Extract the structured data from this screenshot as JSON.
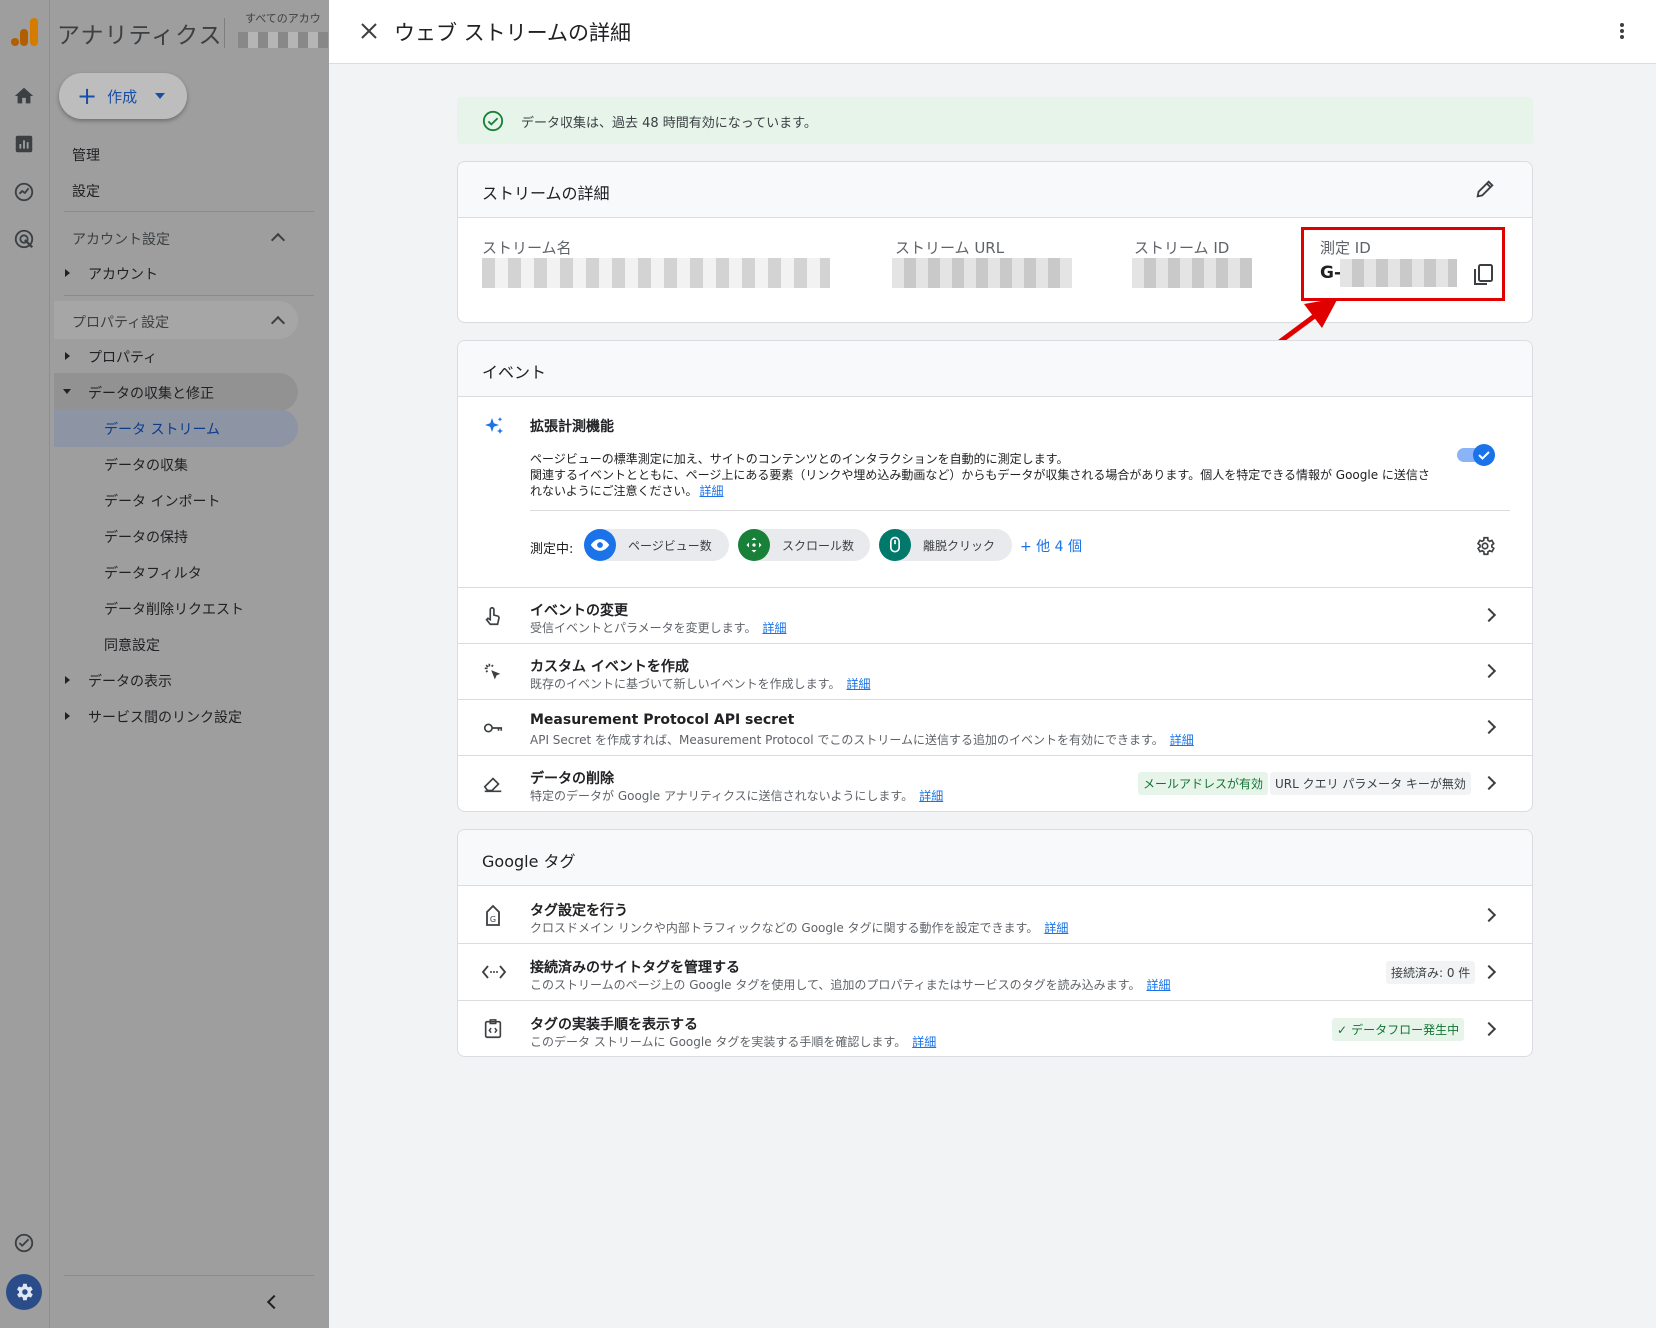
{
  "nav": {
    "app_title": "アナリティクス",
    "account_small": "すべてのアカウ",
    "create_label": "作成",
    "admin": "管理",
    "settings": "設定",
    "account_section": "アカウント設定",
    "account": "アカウント",
    "property_section": "プロパティ設定",
    "property": "プロパティ",
    "data_collection_modification": "データの収集と修正",
    "items": [
      "データ ストリーム",
      "データの収集",
      "データ インポート",
      "データの保持",
      "データフィルタ",
      "データ削除リクエスト",
      "同意設定"
    ],
    "data_display": "データの表示",
    "service_links": "サービス間のリンク設定"
  },
  "header": {
    "title": "ウェブ ストリームの詳細"
  },
  "banner": {
    "text": "データ収集は、過去 48 時間有効になっています。"
  },
  "stream_details": {
    "title": "ストリームの詳細",
    "stream_name_label": "ストリーム名",
    "stream_url_label": "ストリーム URL",
    "stream_id_label": "ストリーム ID",
    "measurement_id_label": "測定 ID",
    "measurement_id_prefix": "G-"
  },
  "events": {
    "title": "イベント",
    "enhanced": {
      "title": "拡張計測機能",
      "desc_line1": "ページビューの標準測定に加え、サイトのコンテンツとのインタラクションを自動的に測定します。",
      "desc_line2": "関連するイベントとともに、ページ上にある要素（リンクや埋め込み動画など）からもデータが収集される場合があります。個人を特定できる情報が Google に送信さ",
      "desc_line3": "れないようにご注意ください。",
      "link": "詳細",
      "toggle_on": true,
      "measuring_label": "測定中:",
      "chips": [
        "ページビュー数",
        "スクロール数",
        "離脱クリック"
      ],
      "more": "+ 他 4 個"
    },
    "rows": [
      {
        "title": "イベントの変更",
        "desc": "受信イベントとパラメータを変更します。",
        "link": "詳細"
      },
      {
        "title": "カスタム イベントを作成",
        "desc": "既存のイベントに基づいて新しいイベントを作成します。",
        "link": "詳細"
      },
      {
        "title": "Measurement Protocol API secret",
        "desc": "API Secret を作成すれば、Measurement Protocol でこのストリームに送信する追加のイベントを有効にできます。",
        "link": "詳細"
      },
      {
        "title": "データの削除",
        "desc": "特定のデータが Google アナリティクスに送信されないようにします。",
        "link": "詳細",
        "badge_email": "メールアドレスが有効",
        "badge_url": "URL クエリ パラメータ キーが無効"
      }
    ]
  },
  "google_tag": {
    "title": "Google タグ",
    "rows": [
      {
        "title": "タグ設定を行う",
        "desc": "クロスドメイン リンクや内部トラフィックなどの Google タグに関する動作を設定できます。",
        "link": "詳細"
      },
      {
        "title": "接続済みのサイトタグを管理する",
        "desc": "このストリームのページ上の Google タグを使用して、追加のプロパティまたはサービスのタグを読み込みます。",
        "link": "詳細",
        "badge": "接続済み: 0 件"
      },
      {
        "title": "タグの実装手順を表示する",
        "desc": "このデータ ストリームに Google タグを実装する手順を確認します。",
        "link": "詳細",
        "badge": "データフロー発生中"
      }
    ]
  },
  "colors": {
    "accent": "#1a73e8",
    "success": "#188038",
    "highlight": "#e10000",
    "overlay": "#9e9e9e"
  }
}
